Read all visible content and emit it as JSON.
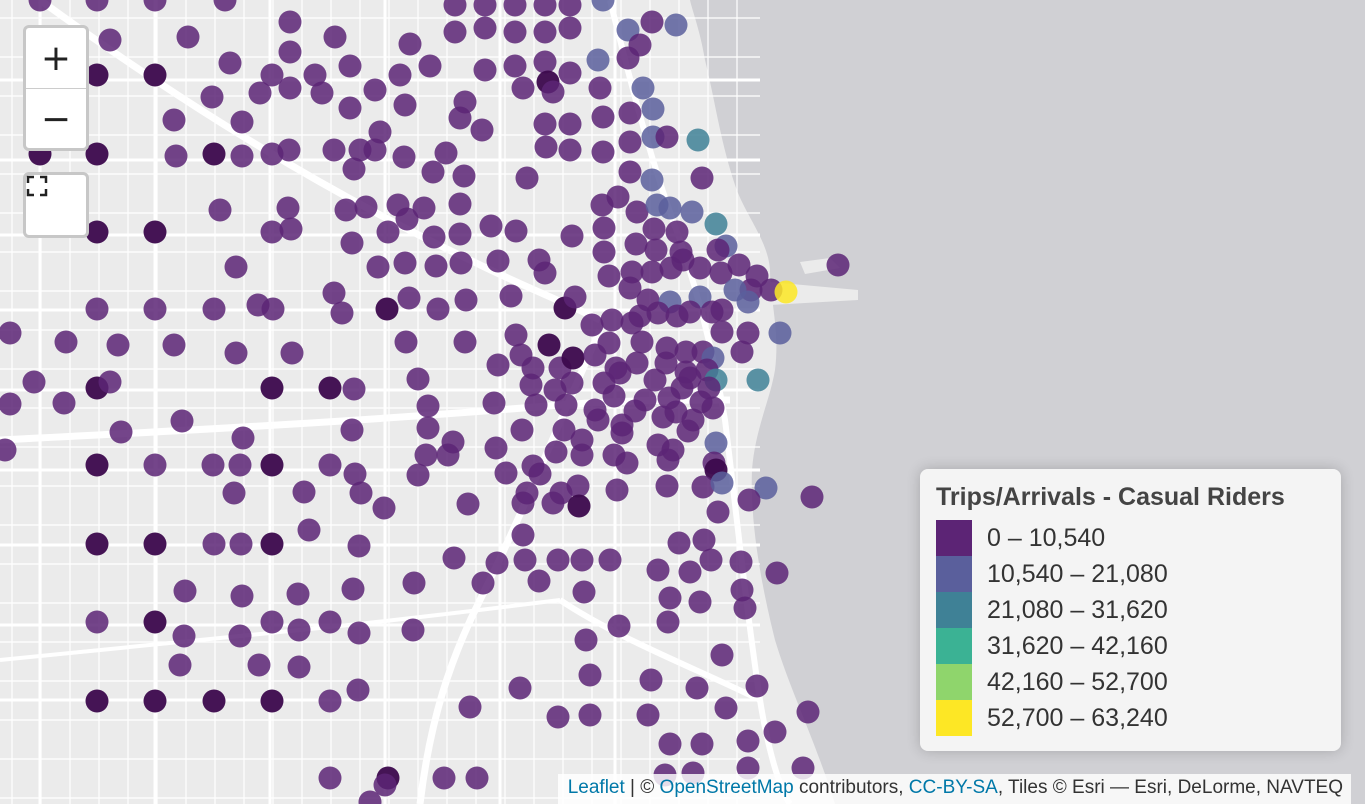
{
  "legend": {
    "title": "Trips/Arrivals - Casual Riders",
    "items": [
      {
        "label": "0 – 10,540",
        "color": "#5c2475"
      },
      {
        "label": "10,540 – 21,080",
        "color": "#5a5f9c"
      },
      {
        "label": "21,080 – 31,620",
        "color": "#3f8196"
      },
      {
        "label": "31,620 – 42,160",
        "color": "#3bb294"
      },
      {
        "label": "42,160 – 52,700",
        "color": "#8fd56c"
      },
      {
        "label": "52,700 – 63,240",
        "color": "#fde725"
      }
    ]
  },
  "controls": {
    "zoom_in": "+",
    "zoom_out": "−"
  },
  "attribution": {
    "leaflet": "Leaflet",
    "sep": " | © ",
    "osm": "OpenStreetMap",
    "contributors": " contributors, ",
    "license": "CC-BY-SA",
    "tiles": ", Tiles © Esri — Esri, DeLorme, NAVTEQ"
  },
  "colors": {
    "land": "#ebebeb",
    "water": "#d0d0d4",
    "road": "#ffffff"
  }
}
